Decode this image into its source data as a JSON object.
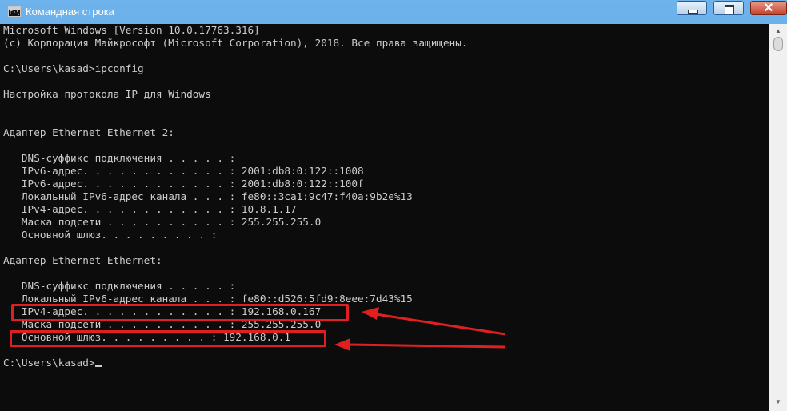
{
  "window": {
    "title": "Командная строка",
    "icon": "cmd-icon",
    "close_glyph": "✕"
  },
  "console": {
    "lines": [
      "Microsoft Windows [Version 10.0.17763.316]",
      "(c) Корпорация Майкрософт (Microsoft Corporation), 2018. Все права защищены.",
      "",
      "C:\\Users\\kasad>ipconfig",
      "",
      "Настройка протокола IP для Windows",
      "",
      "",
      "Адаптер Ethernet Ethernet 2:",
      "",
      "   DNS-суффикс подключения . . . . . :",
      "   IPv6-адрес. . . . . . . . . . . . : 2001:db8:0:122::1008",
      "   IPv6-адрес. . . . . . . . . . . . : 2001:db8:0:122::100f",
      "   Локальный IPv6-адрес канала . . . : fe80::3ca1:9c47:f40a:9b2e%13",
      "   IPv4-адрес. . . . . . . . . . . . : 10.8.1.17",
      "   Маска подсети . . . . . . . . . . : 255.255.255.0",
      "   Основной шлюз. . . . . . . . . :",
      "",
      "Адаптер Ethernet Ethernet:",
      "",
      "   DNS-суффикс подключения . . . . . :",
      "   Локальный IPv6-адрес канала . . . : fe80::d526:5fd9:8eee:7d43%15",
      "   IPv4-адрес. . . . . . . . . . . . : 192.168.0.167",
      "   Маска подсети . . . . . . . . . . : 255.255.255.0",
      "   Основной шлюз. . . . . . . . . : 192.168.0.1",
      ""
    ],
    "prompt": "C:\\Users\\kasad>",
    "text_color": "#cccccc",
    "background": "#0c0c0c"
  },
  "annotations": {
    "color": "#e02020"
  },
  "scrollbar": {
    "up_glyph": "▲",
    "down_glyph": "▼"
  }
}
